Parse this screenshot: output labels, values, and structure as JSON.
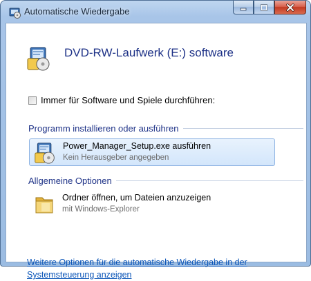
{
  "window": {
    "title": "Automatische Wiedergabe",
    "caption_buttons": [
      "minimize",
      "maximize",
      "close"
    ]
  },
  "header": {
    "title": "DVD-RW-Laufwerk (E:) software",
    "icon": "setup-icon"
  },
  "always_checkbox": {
    "label": "Immer für Software und Spiele durchführen:",
    "checked": false
  },
  "sections": {
    "install": {
      "heading": "Programm installieren oder ausführen",
      "option": {
        "title": "Power_Manager_Setup.exe ausführen",
        "subtitle": "Kein Herausgeber angegeben",
        "icon": "setup-icon",
        "selected": true
      }
    },
    "general": {
      "heading": "Allgemeine Optionen",
      "option": {
        "title": "Ordner öffnen, um Dateien anzuzeigen",
        "subtitle": "mit Windows-Explorer",
        "icon": "folder-icon"
      }
    }
  },
  "footer": {
    "link_text": "Weitere Optionen für die automatische Wiedergabe in der Systemsteuerung anzeigen"
  },
  "colors": {
    "heading_blue": "#1e3287",
    "link_blue": "#0b55b8",
    "close_red": "#c23a22"
  }
}
